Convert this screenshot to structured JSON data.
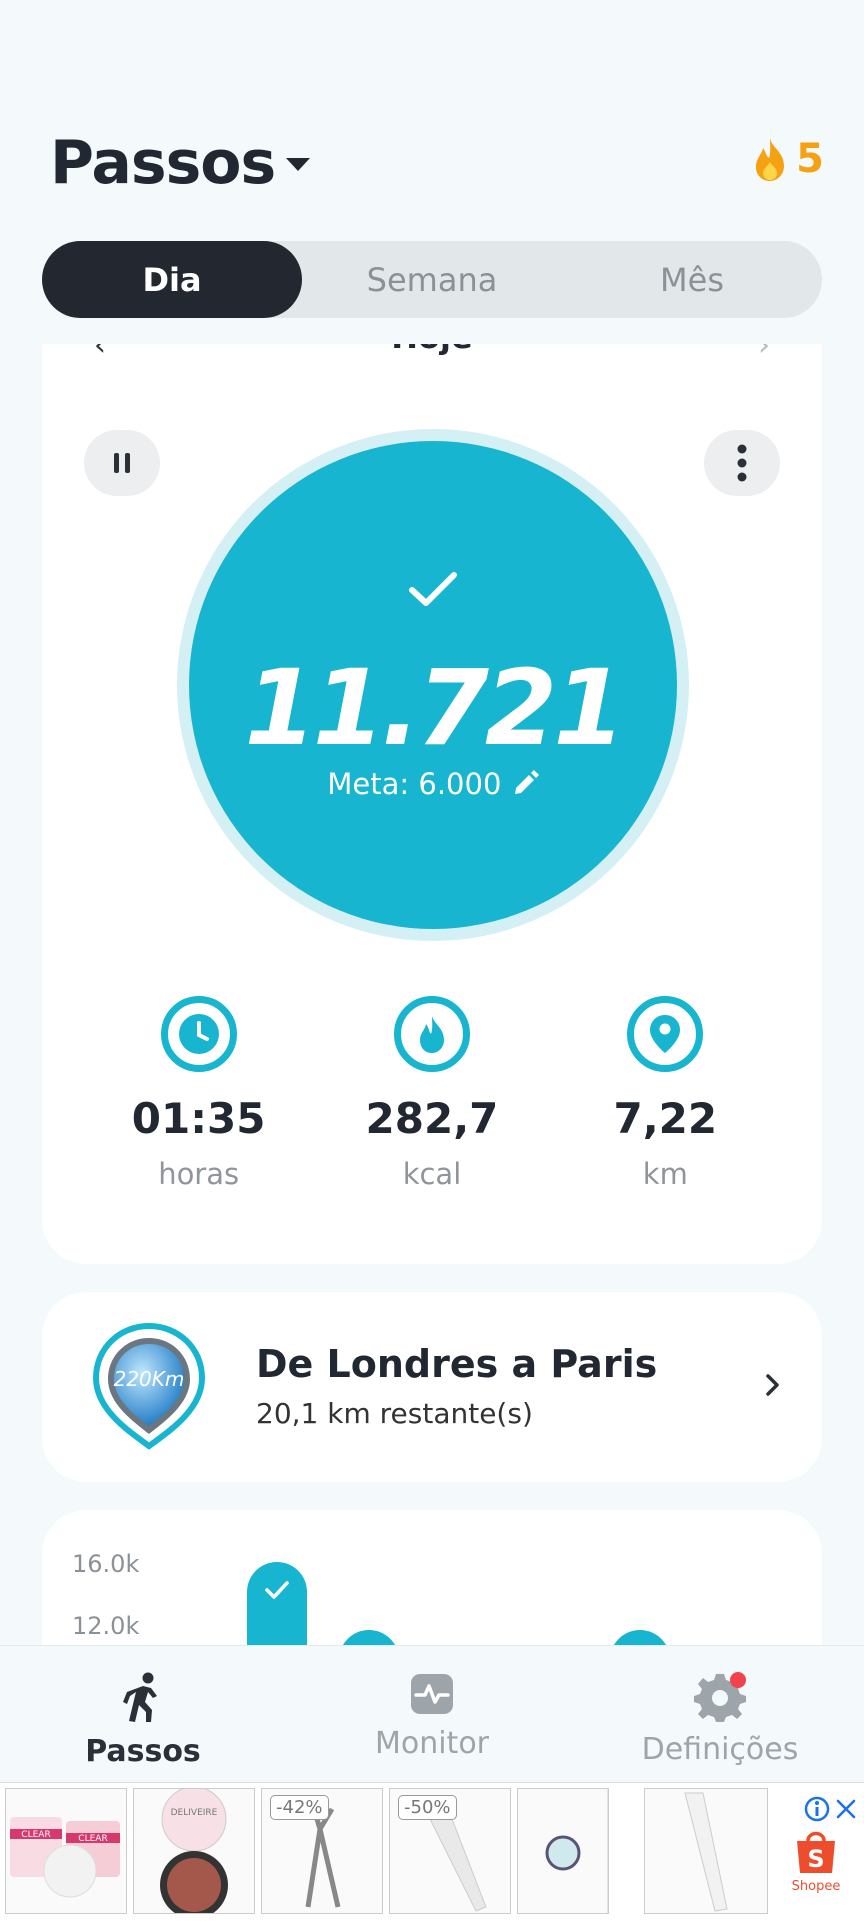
{
  "header": {
    "title": "Passos",
    "streak_count": "5"
  },
  "tabs": [
    {
      "label": "Dia",
      "active": true
    },
    {
      "label": "Semana",
      "active": false
    },
    {
      "label": "Mês",
      "active": false
    }
  ],
  "day": {
    "label": "Hoje"
  },
  "progress": {
    "steps": "11.721",
    "goal_text": "Meta: 6.000",
    "goal_reached": true
  },
  "stats": [
    {
      "icon": "clock-icon",
      "value": "01:35",
      "unit": "horas"
    },
    {
      "icon": "flame-icon",
      "value": "282,7",
      "unit": "kcal"
    },
    {
      "icon": "location-pin-icon",
      "value": "7,22",
      "unit": "km"
    }
  ],
  "challenge": {
    "badge_text": "220Km",
    "title": "De Londres a Paris",
    "subtitle": "20,1 km restante(s)"
  },
  "chart_preview": {
    "ticks": [
      "16.0k",
      "12.0k"
    ]
  },
  "bottom_nav": [
    {
      "label": "Passos",
      "icon": "walking-person-icon",
      "active": true
    },
    {
      "label": "Monitor",
      "icon": "pulse-monitor-icon",
      "active": false
    },
    {
      "label": "Definições",
      "icon": "settings-icon",
      "active": false,
      "notification_dot": true
    }
  ],
  "ad": {
    "discounts": [
      "-42%",
      "-50%"
    ],
    "brand": "Shopee",
    "product_texts": [
      "CLEAR",
      "CLEAR",
      "DELIVEIRE"
    ]
  },
  "colors": {
    "accent": "#17b5cf",
    "dark": "#232830",
    "streak": "#f6a113",
    "shopee": "#ee4d2d"
  }
}
